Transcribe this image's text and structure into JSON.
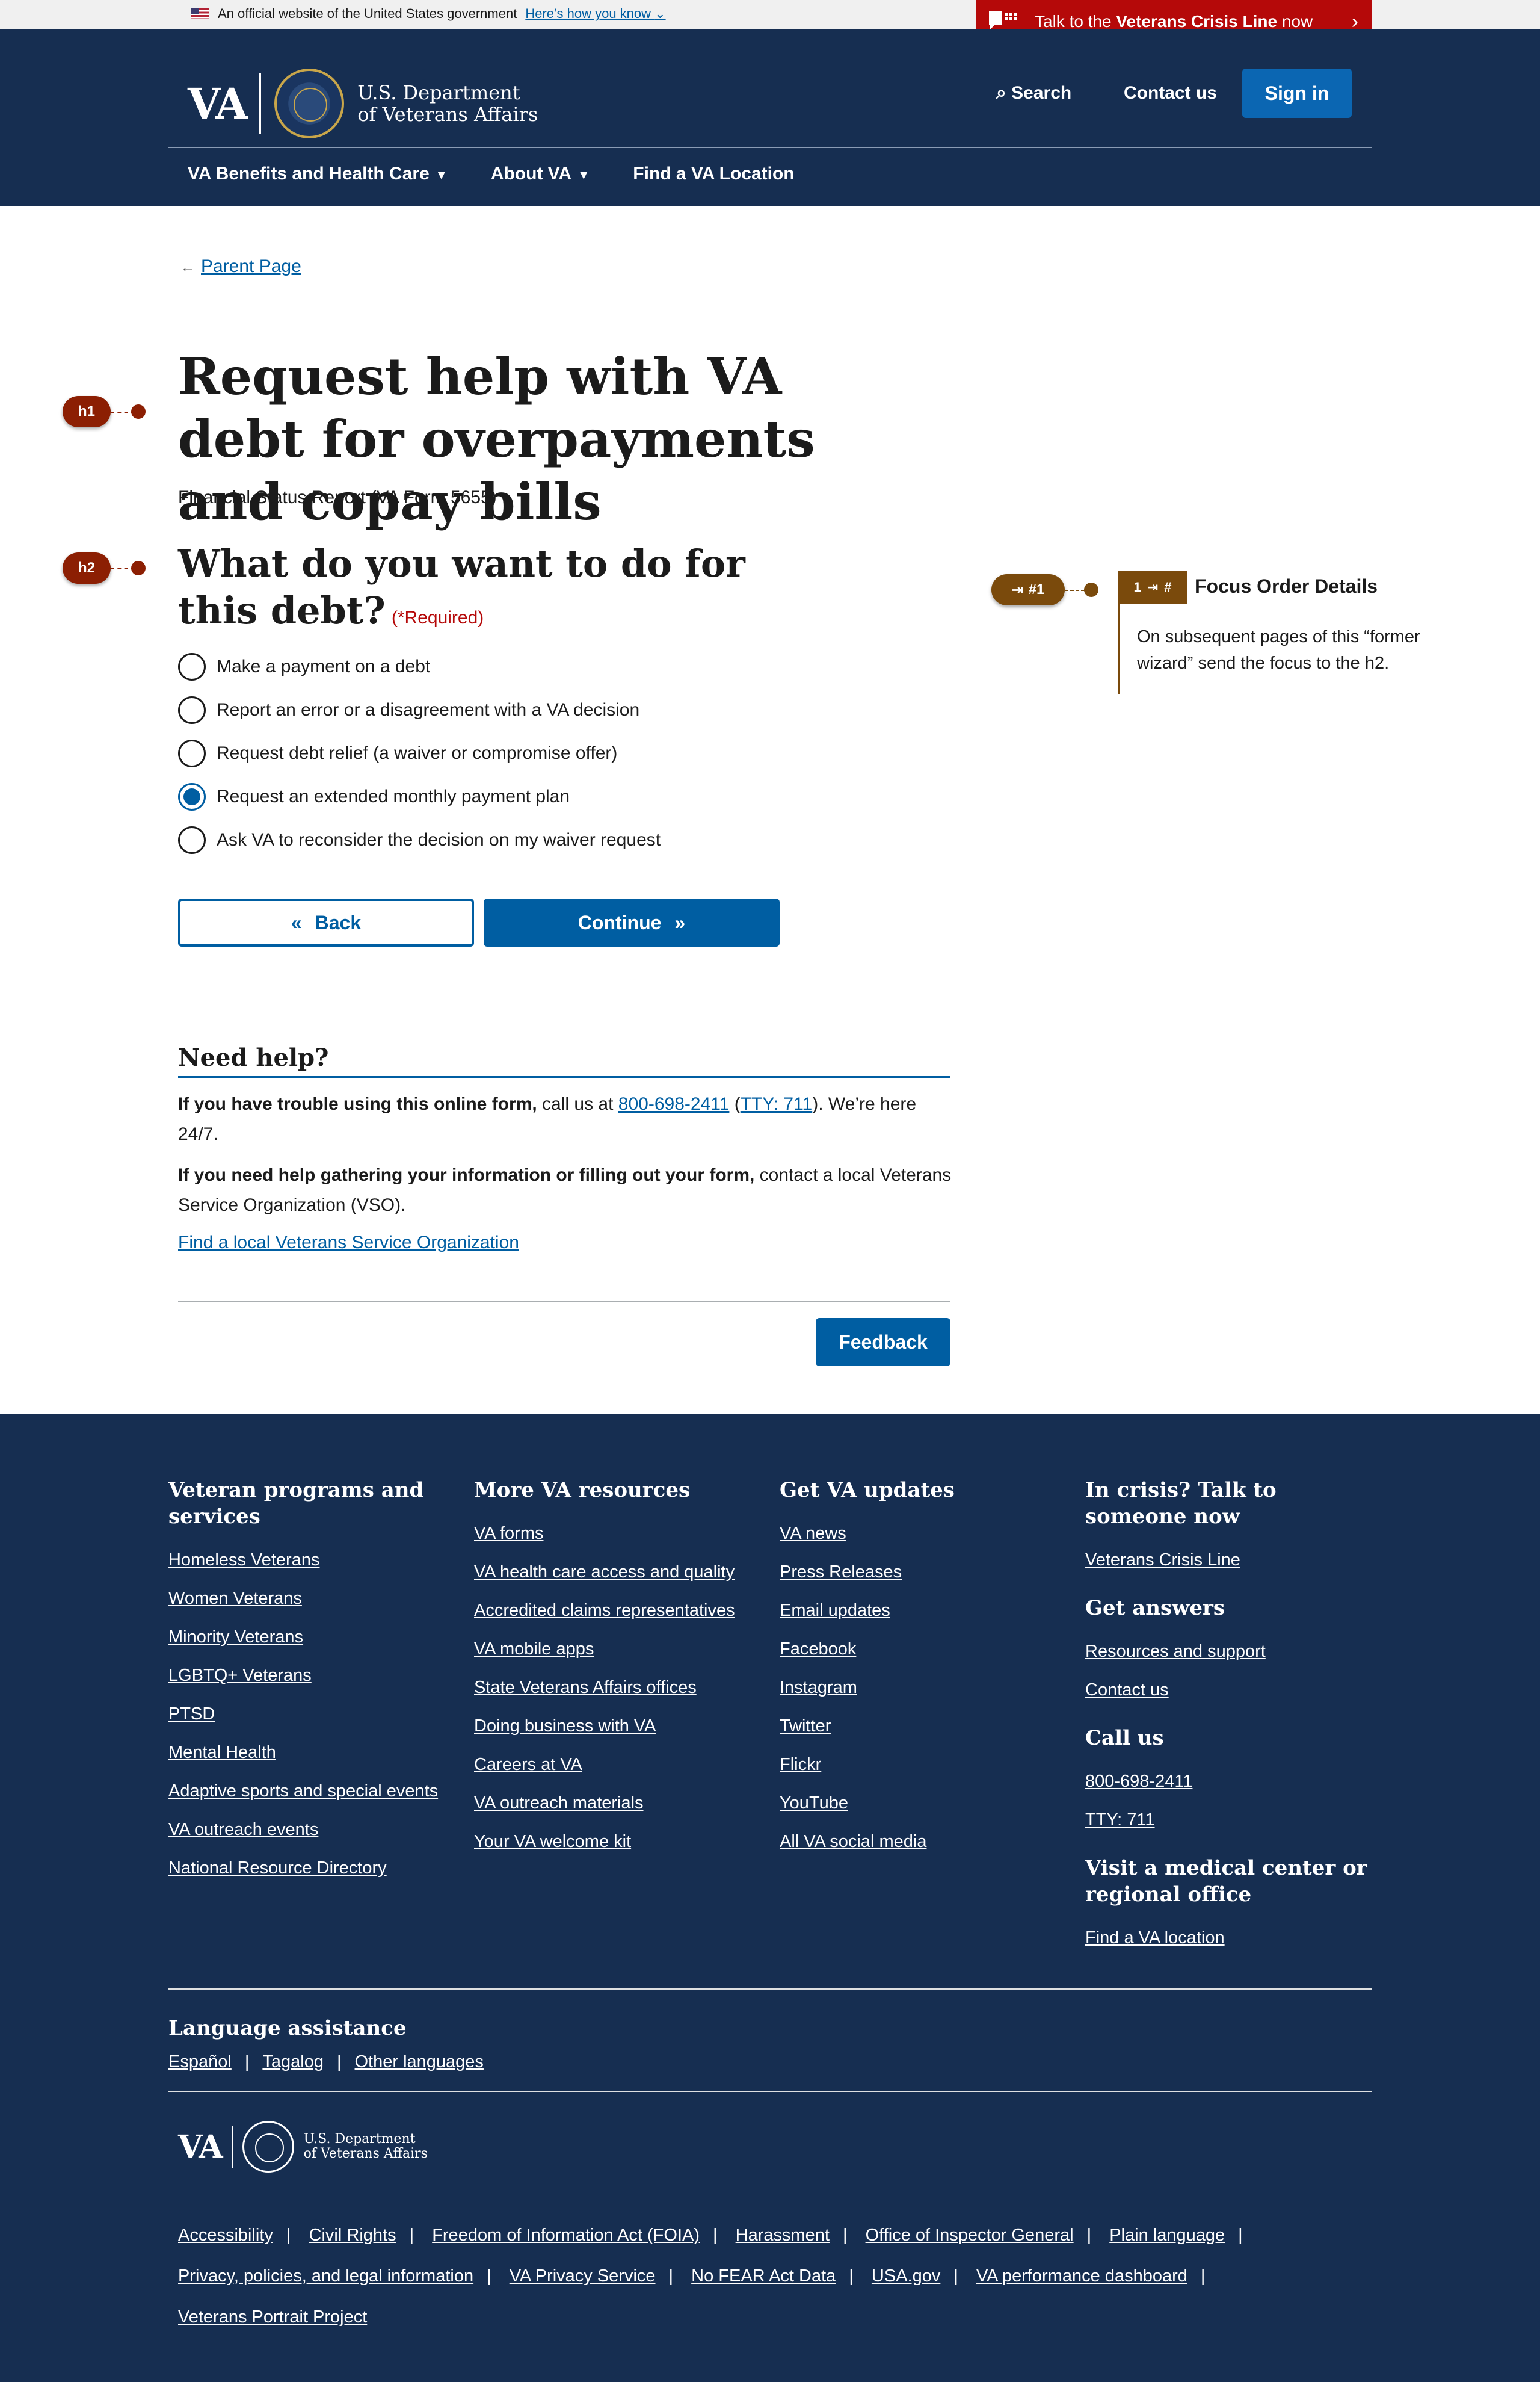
{
  "gov_banner": {
    "text": "An official website of the United States government",
    "link": "Here’s how you know"
  },
  "crisis_banner": {
    "prefix": "Talk to the ",
    "bold": "Veterans Crisis Line",
    "suffix": " now"
  },
  "header": {
    "logo_text": "VA",
    "dept_line1": "U.S. Department",
    "dept_line2": "of Veterans Affairs",
    "search": "Search",
    "contact": "Contact us",
    "sign_in": "Sign in",
    "nav": [
      "VA Benefits and Health Care",
      "About VA",
      "Find a VA Location"
    ]
  },
  "breadcrumb": "Parent Page",
  "annotations": {
    "h1": "h1",
    "h2": "h2",
    "focus_badge": "#1",
    "focus_tag_num": "1",
    "focus_tag_hash": "#"
  },
  "page": {
    "title": "Request help with VA debt for overpayments and copay bills",
    "subtitle": "Financial Status Report (VA Form 5655)",
    "question": "What do you want to do for this debt?",
    "required": "(*Required)",
    "options": [
      {
        "label": "Make a payment on a debt",
        "selected": false
      },
      {
        "label": "Report an error or a disagreement with a VA decision",
        "selected": false
      },
      {
        "label": "Request debt relief (a waiver or compromise offer)",
        "selected": false
      },
      {
        "label": "Request an extended monthly payment plan",
        "selected": true
      },
      {
        "label": "Ask VA to reconsider the decision on my waiver request",
        "selected": false
      }
    ],
    "back": "Back",
    "continue": "Continue"
  },
  "focus_order": {
    "title": "Focus Order Details",
    "body": "On subsequent pages of this “former wizard” send the focus to the h2."
  },
  "need_help": {
    "title": "Need help?",
    "p1_bold": "If you have trouble using this online form,",
    "p1_text": " call us at ",
    "phone": "800-698-2411",
    "tty": "TTY: 711",
    "p1_end": ". We’re here 24/7.",
    "p2_bold": "If you need help gathering your information or filling out your form,",
    "p2_text": " contact a local Veterans Service Organization (VSO).",
    "link": "Find a local Veterans Service Organization",
    "feedback": "Feedback"
  },
  "footer": {
    "col1": {
      "title": "Veteran programs and services",
      "links": [
        "Homeless Veterans",
        "Women Veterans",
        "Minority Veterans",
        "LGBTQ+ Veterans",
        "PTSD",
        "Mental Health",
        "Adaptive sports and special events",
        "VA outreach events",
        "National Resource Directory"
      ]
    },
    "col2": {
      "title": "More VA resources",
      "links": [
        "VA forms",
        "VA health care access and quality",
        "Accredited claims representatives",
        "VA mobile apps",
        "State Veterans Affairs offices",
        "Doing business with VA",
        "Careers at VA",
        "VA outreach materials",
        "Your VA welcome kit"
      ]
    },
    "col3": {
      "title": "Get VA updates",
      "links": [
        "VA news",
        "Press Releases",
        "Email updates",
        "Facebook",
        "Instagram",
        "Twitter",
        "Flickr",
        "YouTube",
        "All VA social media"
      ]
    },
    "col4": {
      "crisis_title": "In crisis? Talk to someone now",
      "crisis_link": "Veterans Crisis Line",
      "answers_title": "Get answers",
      "answers_links": [
        "Resources and support",
        "Contact us"
      ],
      "call_title": "Call us",
      "call_links": [
        "800-698-2411",
        "TTY: 711"
      ],
      "visit_title": "Visit a medical center or regional office",
      "visit_link": "Find a VA location"
    },
    "lang_title": "Language assistance",
    "languages": [
      "Español",
      "Tagalog",
      "Other languages"
    ],
    "legal": [
      "Accessibility",
      "Civil Rights",
      "Freedom of Information Act (FOIA)",
      "Harassment",
      "Office of Inspector General",
      "Plain language",
      "Privacy, policies, and legal information",
      "VA Privacy Service",
      "No FEAR Act Data",
      "USA.gov",
      "VA performance dashboard",
      "Veterans Portrait Project"
    ]
  },
  "colors": {
    "primary": "#005ea2",
    "navy": "#162e51",
    "crisis_red": "#b50909",
    "annotation": "#8c1f03"
  }
}
